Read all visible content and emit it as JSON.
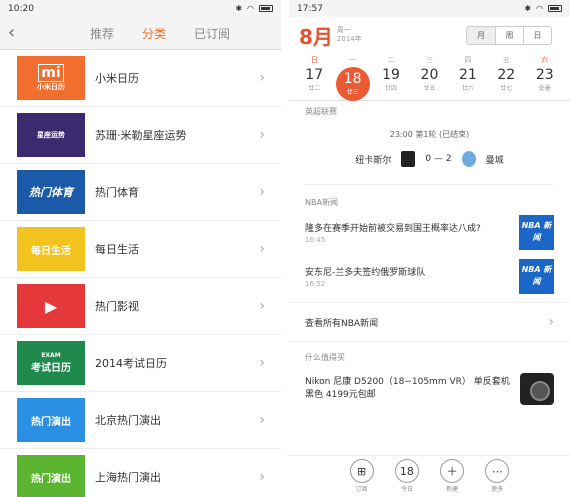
{
  "left": {
    "status": {
      "time": "10:20"
    },
    "tabs": [
      {
        "label": "推荐",
        "active": false
      },
      {
        "label": "分类",
        "active": true
      },
      {
        "label": "已订阅",
        "active": false
      }
    ],
    "categories": [
      {
        "label": "小米日历",
        "thumb_text": "小米日历",
        "thumb_color": "#f26e2e"
      },
      {
        "label": "苏珊·米勒星座运势",
        "thumb_text": "星座运势",
        "thumb_color": "#3a2a6e"
      },
      {
        "label": "热门体育",
        "thumb_text": "热门体育",
        "thumb_color": "#1a5aa8"
      },
      {
        "label": "每日生活",
        "thumb_text": "每日生活",
        "thumb_color": "#f2c21e"
      },
      {
        "label": "热门影视",
        "thumb_text": "",
        "thumb_color": "#e5383b"
      },
      {
        "label": "2014考试日历",
        "thumb_text": "考试日历",
        "thumb_color": "#1f8a4c"
      },
      {
        "label": "北京热门演出",
        "thumb_text": "热门演出",
        "thumb_color": "#2b8fe3"
      },
      {
        "label": "上海热门演出",
        "thumb_text": "热门演出",
        "thumb_color": "#5cb531"
      }
    ]
  },
  "right": {
    "status": {
      "time": "17:57"
    },
    "month": "8月",
    "weekday": "周一",
    "year": "2014年",
    "view_tabs": [
      "月",
      "周",
      "日"
    ],
    "weekdays": [
      "日",
      "一",
      "二",
      "三",
      "四",
      "五",
      "六"
    ],
    "dates": [
      {
        "day": "17",
        "lunar": "廿二"
      },
      {
        "day": "18",
        "lunar": "廿三",
        "today": true
      },
      {
        "day": "19",
        "lunar": "廿四"
      },
      {
        "day": "20",
        "lunar": "廿五"
      },
      {
        "day": "21",
        "lunar": "廿六"
      },
      {
        "day": "22",
        "lunar": "廿七"
      },
      {
        "day": "23",
        "lunar": "处暑"
      }
    ],
    "league_title": "英超联赛",
    "match": {
      "info": "23:00 第1轮 (已结束)",
      "home": "纽卡斯尔",
      "score": "0 — 2",
      "away": "曼城"
    },
    "nba_title": "NBA新闻",
    "news": [
      {
        "title": "隆多在赛季开始前被交易到国王概率达八成?",
        "time": "16:45",
        "thumb": "NBA 新闻"
      },
      {
        "title": "安东尼-兰多夫签约俄罗斯球队",
        "time": "16:52",
        "thumb": "NBA 新闻"
      }
    ],
    "more_news": "查看所有NBA新闻",
    "buy_title": "什么值得买",
    "buy_item": "Nikon 尼康 D5200（18−105mm VR） 单反套机 黑色 4199元包邮",
    "bottom": [
      {
        "icon": "grid-icon",
        "label": "订阅"
      },
      {
        "icon": "today-icon",
        "label": "今日",
        "value": "18"
      },
      {
        "icon": "plus-icon",
        "label": "新建"
      },
      {
        "icon": "more-icon",
        "label": "更多"
      }
    ]
  }
}
